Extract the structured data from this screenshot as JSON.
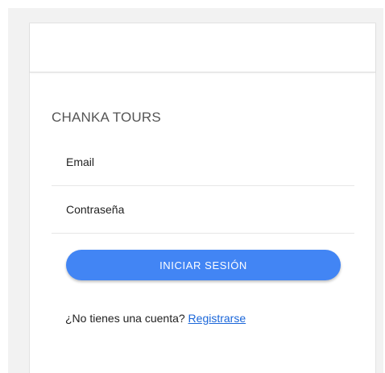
{
  "brand": {
    "title": "CHANKA TOURS"
  },
  "form": {
    "email_placeholder": "Email",
    "password_placeholder": "Contraseña",
    "submit_label": "INICIAR SESIÓN"
  },
  "signup": {
    "prompt": "¿No tienes una cuenta?",
    "link_label": "Registrarse"
  },
  "colors": {
    "accent": "#4285f4",
    "link": "#1a66d9",
    "background": "#f2f2f2"
  }
}
